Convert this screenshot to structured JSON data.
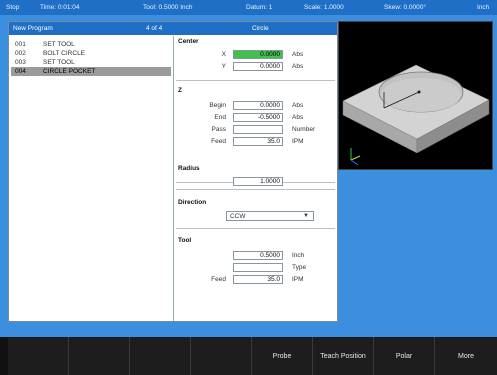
{
  "status": {
    "mode": "Stop",
    "time": "Time: 0:01:04",
    "tool": "Tool: 0.5000 Inch",
    "datum": "Datum: 1",
    "scale": "Scale: 1.0000",
    "skew": "Skew: 0.0000°",
    "units": "Inch"
  },
  "program": {
    "name": "New Program",
    "position": "4 of 4",
    "current_type": "Circle",
    "steps": [
      {
        "num": "001",
        "name": "SET TOOL"
      },
      {
        "num": "002",
        "name": "BOLT CIRCLE"
      },
      {
        "num": "003",
        "name": "SET TOOL"
      },
      {
        "num": "004",
        "name": "CIRCLE POCKET"
      }
    ]
  },
  "detail": {
    "center": {
      "title": "Center",
      "x_label": "X",
      "x_value": "0.0000",
      "x_unit": "Abs",
      "y_label": "Y",
      "y_value": "0.0000",
      "y_unit": "Abs"
    },
    "z": {
      "title": "Z",
      "begin_label": "Begin",
      "begin_value": "0.0000",
      "begin_unit": "Abs",
      "end_label": "End",
      "end_value": "-0.5000",
      "end_unit": "Abs",
      "pass_label": "Pass",
      "pass_value": "",
      "pass_unit": "Number",
      "feed_label": "Feed",
      "feed_value": "35.0",
      "feed_unit": "IPM"
    },
    "radius": {
      "title": "Radius",
      "value": "1.0000"
    },
    "direction": {
      "title": "Direction",
      "value": "CCW"
    },
    "tool": {
      "title": "Tool",
      "value": "0.5000",
      "unit": "Inch",
      "type_label": "Type",
      "type_value": "",
      "feed_label": "Feed",
      "feed_value": "35.0",
      "feed_unit": "IPM"
    }
  },
  "softkeys": [
    "",
    "",
    "",
    "",
    "Probe",
    "Teach Position",
    "Polar",
    "More"
  ],
  "colors": {
    "accent": "#1f6fc7",
    "background": "#3b8fde",
    "highlight": "#3ec24a"
  }
}
